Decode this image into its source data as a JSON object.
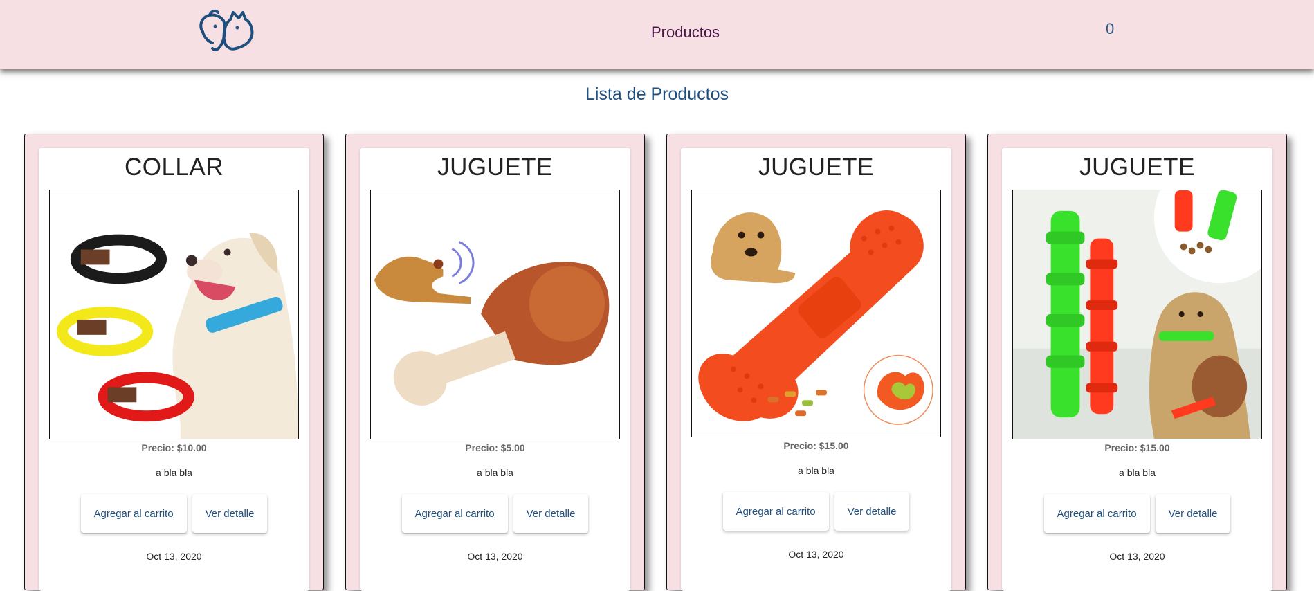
{
  "navbar": {
    "logo_icon": "cat-dog-logo-icon",
    "link_label": "Productos",
    "cart_count": "0"
  },
  "page": {
    "title": "Lista de Productos"
  },
  "products": [
    {
      "title": "COLLAR",
      "price": "Precio: $10.00",
      "description": "a bla bla",
      "add_label": "Agregar al carrito",
      "detail_label": "Ver detalle",
      "date": "Oct 13, 2020",
      "image_icon": "dog-collars-image"
    },
    {
      "title": "JUGUETE",
      "price": "Precio: $5.00",
      "description": "a bla bla",
      "add_label": "Agregar al carrito",
      "detail_label": "Ver detalle",
      "date": "Oct 13, 2020",
      "image_icon": "chicken-leg-toy-image"
    },
    {
      "title": "JUGUETE",
      "price": "Precio: $15.00",
      "description": "a bla bla",
      "add_label": "Agregar al carrito",
      "detail_label": "Ver detalle",
      "date": "Oct 13, 2020",
      "image_icon": "bone-chew-toy-image"
    },
    {
      "title": "JUGUETE",
      "price": "Precio: $15.00",
      "description": "a bla bla",
      "add_label": "Agregar al carrito",
      "detail_label": "Ver detalle",
      "date": "Oct 13, 2020",
      "image_icon": "stick-chew-toys-image"
    }
  ]
}
